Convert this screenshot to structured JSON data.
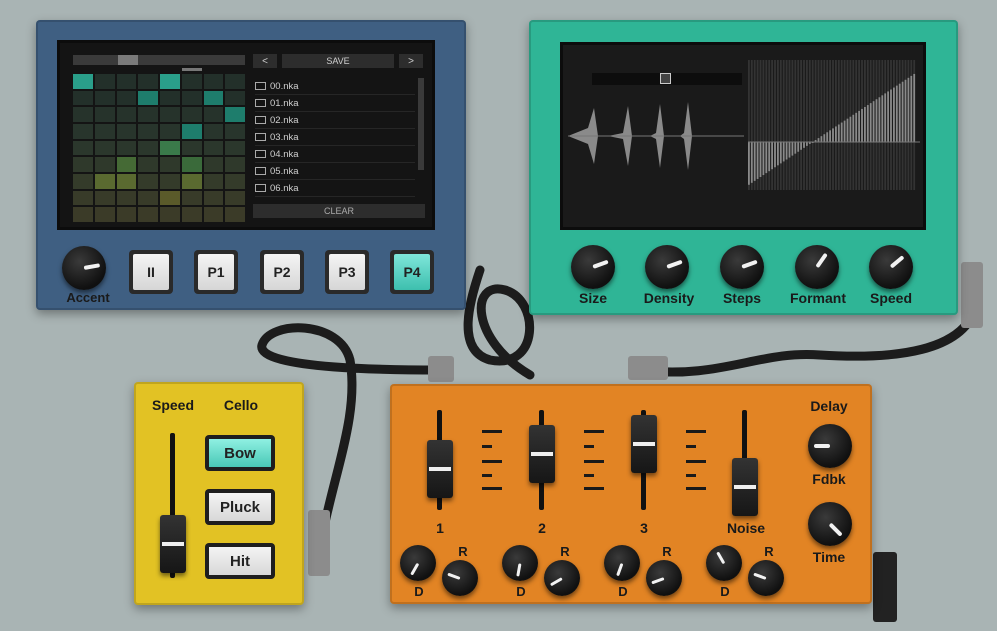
{
  "blue_module": {
    "file_browser": {
      "save_label": "SAVE",
      "prev_label": "<",
      "next_label": ">",
      "clear_label": "CLEAR",
      "files": [
        "00.nka",
        "01.nka",
        "02.nka",
        "03.nka",
        "04.nka",
        "05.nka",
        "06.nka"
      ]
    },
    "accent_label": "Accent",
    "pause_label": "II",
    "patterns": [
      "P1",
      "P2",
      "P3",
      "P4"
    ],
    "active_pattern": "P4"
  },
  "teal_module": {
    "knobs": [
      "Size",
      "Density",
      "Steps",
      "Formant",
      "Speed"
    ]
  },
  "yellow_module": {
    "speed_label": "Speed",
    "title": "Cello",
    "buttons": [
      "Bow",
      "Pluck",
      "Hit"
    ],
    "active_button": "Bow"
  },
  "orange_module": {
    "channels": [
      "1",
      "2",
      "3",
      "Noise"
    ],
    "decay_label": "D",
    "release_label": "R",
    "delay_label": "Delay",
    "fdbk_label": "Fdbk",
    "time_label": "Time"
  },
  "colors": {
    "blue_panel": "#3f5f82",
    "teal_panel": "#2fb596",
    "yellow_panel": "#e2c224",
    "orange_panel": "#e28424",
    "active_button": "#49c8b6"
  }
}
